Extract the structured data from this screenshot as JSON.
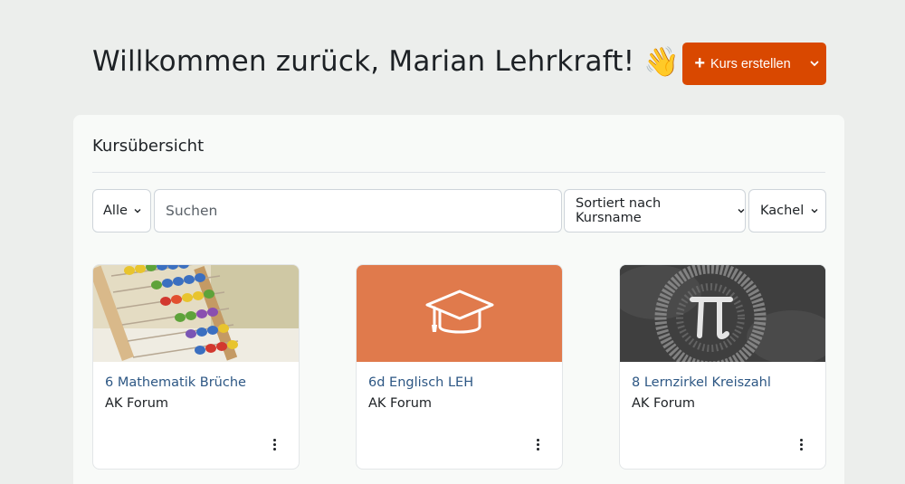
{
  "header": {
    "greeting": "Willkommen zurück, Marian Lehrkraft!",
    "wave_emoji": "👋",
    "create_button_label": "Kurs erstellen",
    "create_button_plus": "+",
    "create_button_color": "#d94800"
  },
  "overview": {
    "title": "Kursübersicht",
    "filter_label": "Alle",
    "search_placeholder": "Suchen",
    "sort_label": "Sortiert nach Kursname",
    "view_label": "Kachel"
  },
  "courses": [
    {
      "name": "6 Mathematik Brüche",
      "category": "AK Forum",
      "image": "abacus-image"
    },
    {
      "name": "6d Englisch LEH",
      "category": "AK Forum",
      "image": "graduation-cap-icon",
      "color": "#e07a4c"
    },
    {
      "name": "8 Lernzirkel Kreiszahl",
      "category": "AK Forum",
      "image": "pi-image"
    }
  ],
  "icons": {
    "chevron": "chevron-down-icon",
    "menu": "more-vertical-icon"
  }
}
